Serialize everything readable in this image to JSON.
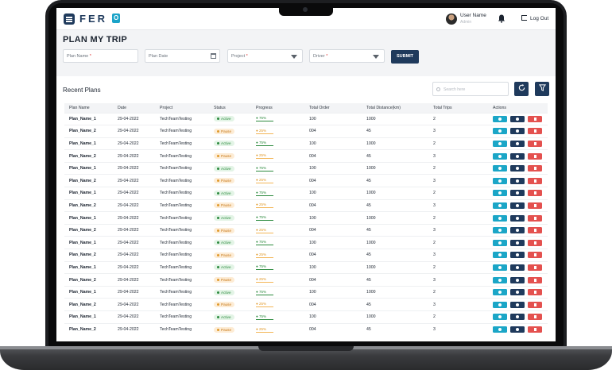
{
  "app": {
    "brand": "FER",
    "brand_o": "O"
  },
  "header": {
    "user_name": "User Name",
    "user_role": "Admin",
    "logout_label": "Log Out"
  },
  "form": {
    "title": "PLAN MY TRIP",
    "plan_name": "Plan Name",
    "plan_date": "Plan Date",
    "project": "Project",
    "driver": "Driver",
    "required_mark": "*",
    "submit_label": "SUBMIT"
  },
  "recent": {
    "title": "Recent Plans",
    "search_placeholder": "Search here"
  },
  "table": {
    "columns": [
      "Plan Name",
      "Date",
      "Project",
      "Status",
      "Progress",
      "Total Order",
      "Total Distance(km)",
      "Total Trips",
      "Actions"
    ],
    "rows": [
      {
        "name": "Plan_Name_1",
        "date": "29-04-2022",
        "project": "TechTeamTesting",
        "status": "Active",
        "progress": "75%",
        "order": "100",
        "distance": "1000",
        "trips": "2"
      },
      {
        "name": "Plan_Name_2",
        "date": "29-04-2022",
        "project": "TechTeamTesting",
        "status": "Pause",
        "progress": "25%",
        "order": "004",
        "distance": "45",
        "trips": "3"
      },
      {
        "name": "Plan_Name_1",
        "date": "29-04-2022",
        "project": "TechTeamTesting",
        "status": "Active",
        "progress": "75%",
        "order": "100",
        "distance": "1000",
        "trips": "2"
      },
      {
        "name": "Plan_Name_2",
        "date": "29-04-2022",
        "project": "TechTeamTesting",
        "status": "Pause",
        "progress": "25%",
        "order": "004",
        "distance": "45",
        "trips": "3"
      },
      {
        "name": "Plan_Name_1",
        "date": "29-04-2022",
        "project": "TechTeamTesting",
        "status": "Active",
        "progress": "75%",
        "order": "100",
        "distance": "1000",
        "trips": "2"
      },
      {
        "name": "Plan_Name_2",
        "date": "29-04-2022",
        "project": "TechTeamTesting",
        "status": "Pause",
        "progress": "25%",
        "order": "004",
        "distance": "45",
        "trips": "3"
      },
      {
        "name": "Plan_Name_1",
        "date": "29-04-2022",
        "project": "TechTeamTesting",
        "status": "Active",
        "progress": "75%",
        "order": "100",
        "distance": "1000",
        "trips": "2"
      },
      {
        "name": "Plan_Name_2",
        "date": "29-04-2022",
        "project": "TechTeamTesting",
        "status": "Pause",
        "progress": "25%",
        "order": "004",
        "distance": "45",
        "trips": "3"
      },
      {
        "name": "Plan_Name_1",
        "date": "29-04-2022",
        "project": "TechTeamTesting",
        "status": "Active",
        "progress": "75%",
        "order": "100",
        "distance": "1000",
        "trips": "2"
      },
      {
        "name": "Plan_Name_2",
        "date": "29-04-2022",
        "project": "TechTeamTesting",
        "status": "Pause",
        "progress": "25%",
        "order": "004",
        "distance": "45",
        "trips": "3"
      },
      {
        "name": "Plan_Name_1",
        "date": "29-04-2022",
        "project": "TechTeamTesting",
        "status": "Active",
        "progress": "75%",
        "order": "100",
        "distance": "1000",
        "trips": "2"
      },
      {
        "name": "Plan_Name_2",
        "date": "29-04-2022",
        "project": "TechTeamTesting",
        "status": "Pause",
        "progress": "25%",
        "order": "004",
        "distance": "45",
        "trips": "3"
      },
      {
        "name": "Plan_Name_1",
        "date": "29-04-2022",
        "project": "TechTeamTesting",
        "status": "Active",
        "progress": "75%",
        "order": "100",
        "distance": "1000",
        "trips": "2"
      },
      {
        "name": "Plan_Name_2",
        "date": "29-04-2022",
        "project": "TechTeamTesting",
        "status": "Pause",
        "progress": "25%",
        "order": "004",
        "distance": "45",
        "trips": "3"
      },
      {
        "name": "Plan_Name_1",
        "date": "29-04-2022",
        "project": "TechTeamTesting",
        "status": "Active",
        "progress": "75%",
        "order": "100",
        "distance": "1000",
        "trips": "2"
      },
      {
        "name": "Plan_Name_2",
        "date": "29-04-2022",
        "project": "TechTeamTesting",
        "status": "Pause",
        "progress": "25%",
        "order": "004",
        "distance": "45",
        "trips": "3"
      },
      {
        "name": "Plan_Name_1",
        "date": "29-04-2022",
        "project": "TechTeamTesting",
        "status": "Active",
        "progress": "75%",
        "order": "100",
        "distance": "1000",
        "trips": "2"
      },
      {
        "name": "Plan_Name_2",
        "date": "29-04-2022",
        "project": "TechTeamTesting",
        "status": "Pause",
        "progress": "25%",
        "order": "004",
        "distance": "45",
        "trips": "3"
      }
    ]
  },
  "colors": {
    "primary": "#1f3a5c",
    "accent": "#1ba6c7",
    "danger": "#e4514f",
    "active": "#2c8a3e",
    "pause": "#e09a2c"
  },
  "icons": [
    "menu-icon",
    "bell-icon",
    "logout-icon",
    "calendar-icon",
    "chevron-down-icon",
    "search-icon",
    "refresh-icon",
    "filter-icon",
    "info-icon",
    "eye-icon",
    "trash-icon"
  ]
}
